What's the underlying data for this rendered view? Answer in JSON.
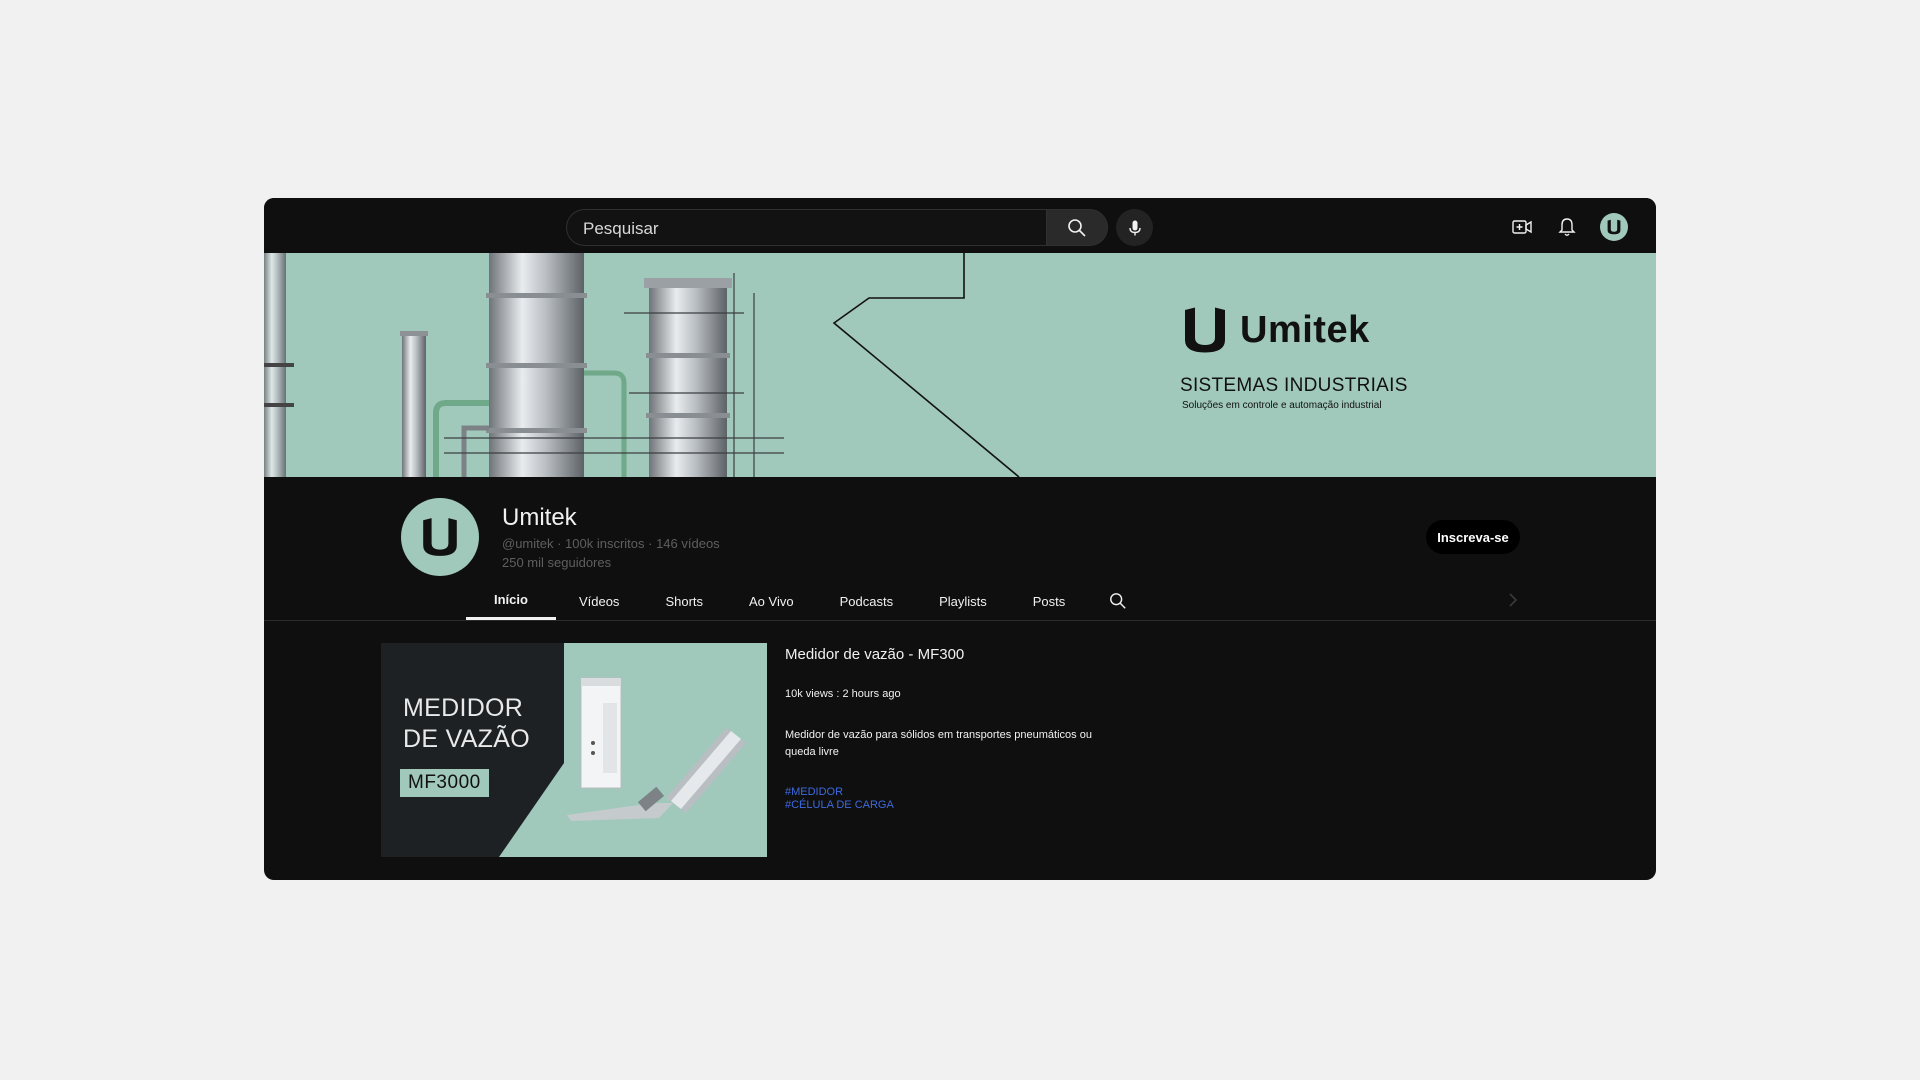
{
  "topbar": {
    "search_placeholder": "Pesquisar",
    "icons": [
      "search-icon",
      "mic-icon",
      "create-video-icon",
      "bell-icon",
      "avatar"
    ]
  },
  "banner": {
    "brand_name": "Umitek",
    "tagline": "SISTEMAS INDUSTRIAIS",
    "subline": "Soluções em controle e automação industrial"
  },
  "channel": {
    "name": "Umitek",
    "meta": "@umitek · 100k inscritos  · 146 vídeos",
    "followers": "250 mil seguidores",
    "subscribe_label": "Inscreva-se"
  },
  "tabs": [
    {
      "label": "Início",
      "active": true
    },
    {
      "label": "Vídeos"
    },
    {
      "label": "Shorts"
    },
    {
      "label": "Ao Vivo"
    },
    {
      "label": "Podcasts"
    },
    {
      "label": "Playlists"
    },
    {
      "label": "Posts"
    }
  ],
  "featured": {
    "thumb_line1": "MEDIDOR",
    "thumb_line2": "DE VAZÃO",
    "thumb_badge": "MF3000",
    "title": "Medidor de vazão - MF300",
    "stats": "10k views : 2 hours ago",
    "description": "Medidor de vazão para sólidos em transportes pneumáticos ou queda livre",
    "tags": [
      "#MEDIDOR",
      "#CÉLULA DE CARGA"
    ]
  },
  "colors": {
    "accent_mint": "#a0c8bb",
    "background": "#0f0f0f",
    "tag_blue": "#3e6ae0"
  }
}
